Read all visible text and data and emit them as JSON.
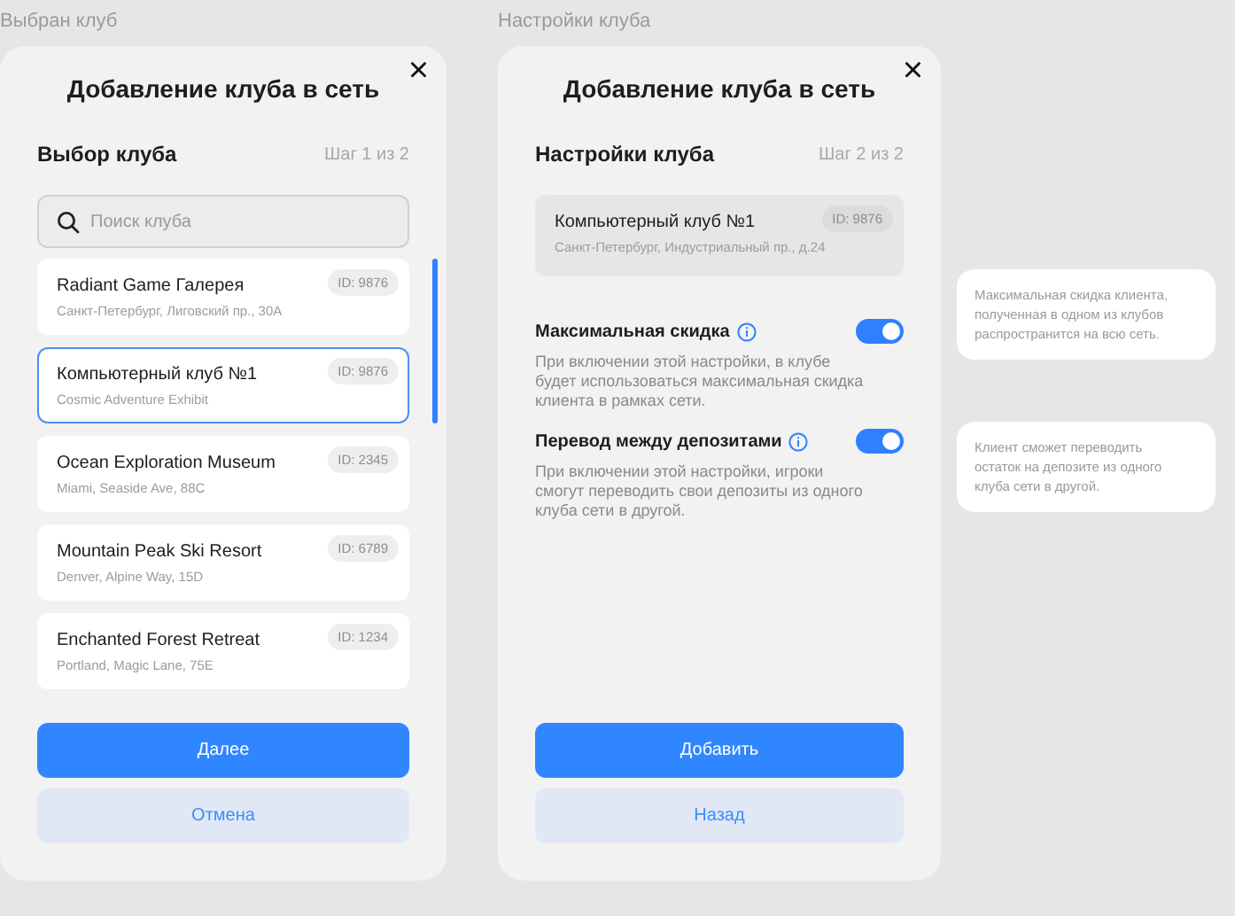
{
  "screens": [
    {
      "caption": "Выбран клуб",
      "title": "Добавление клуба в сеть",
      "close": "×",
      "section": "Выбор клуба",
      "step": "Шаг 1 из 2",
      "search": {
        "placeholder": "Поиск клуба"
      },
      "clubs": [
        {
          "name": "Radiant Game Галерея",
          "address": "Санкт-Петербург, Лиговский пр., 30А",
          "id": "ID: 9876",
          "selected": false
        },
        {
          "name": "Компьютерный клуб №1",
          "address": "Cosmic Adventure Exhibit",
          "id": "ID: 9876",
          "selected": true
        },
        {
          "name": "Ocean Exploration Museum",
          "address": "Miami, Seaside Ave, 88C",
          "id": "ID: 2345",
          "selected": false
        },
        {
          "name": "Mountain Peak Ski Resort",
          "address": "Denver, Alpine Way, 15D",
          "id": "ID: 6789",
          "selected": false
        },
        {
          "name": "Enchanted Forest Retreat",
          "address": "Portland, Magic Lane, 75E",
          "id": "ID: 1234",
          "selected": false
        }
      ],
      "primary_button": "Далее",
      "secondary_button": "Отмена"
    },
    {
      "caption": "Настройки клуба",
      "title": "Добавление клуба в сеть",
      "close": "×",
      "section": "Настройки клуба",
      "step": "Шаг 2 из 2",
      "club": {
        "name": "Компьютерный клуб №1",
        "address": "Санкт-Петербург, Индустриальный пр., д.24",
        "id": "ID: 9876"
      },
      "settings": [
        {
          "label": "Максимальная скидка",
          "description": "При включении этой настройки, в клубе будет использоваться максимальная скидка клиента в рамках сети.",
          "on": true
        },
        {
          "label": "Перевод между депозитами",
          "description": "При включении этой настройки, игроки смогут переводить свои депозиты из одного клуба сети в другой.",
          "on": true
        }
      ],
      "primary_button": "Добавить",
      "secondary_button": "Назад"
    }
  ],
  "tooltips": [
    "Максимальная скидка клиента, полученная в одном из клубов распространится на всю сеть.",
    "Клиент сможет переводить остаток на депозите из одного клуба сети в другой."
  ]
}
